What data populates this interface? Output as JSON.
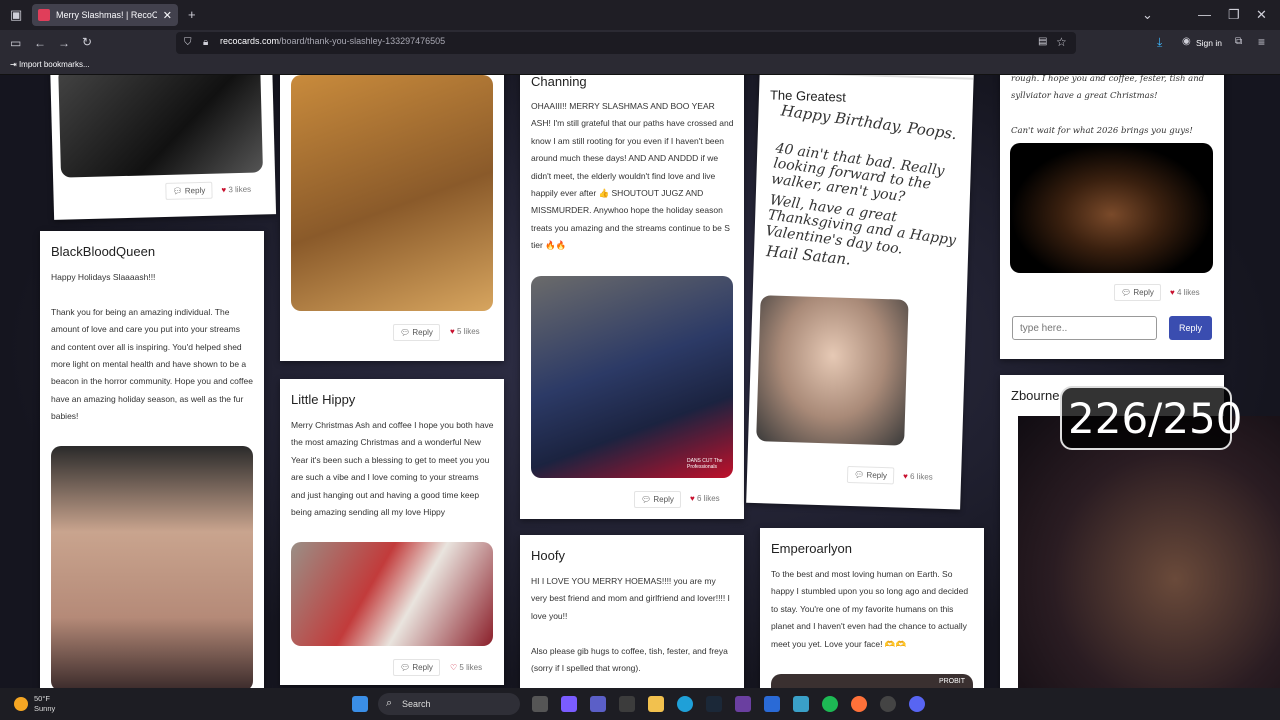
{
  "browser": {
    "tab_title": "Merry Slashmas! | RecoCards.co",
    "url_domain": "recocards.com",
    "url_path": "/board/thank-you-slashley-133297476505",
    "bookmark": "Import bookmarks...",
    "sign_in": "Sign in"
  },
  "ui": {
    "reply": "Reply",
    "reply_input_placeholder": "type here..",
    "reply_submit": "Reply"
  },
  "cards": {
    "top_left_likes": "3 likes",
    "cat_likes": "5 likes",
    "blackblood": {
      "name": "BlackBloodQueen",
      "message": "Happy Holidays Slaaaash!!!\n\nThank you for being an amazing individual. The amount of love and care you put into your streams and content over all is inspiring. You'd helped shed more light on mental health and have shown to be a beacon in the horror community. Hope you and coffee have an amazing holiday season, as well as the fur babies!"
    },
    "little_hippy": {
      "name": "Little Hippy",
      "message": "Merry Christmas Ash and coffee I hope you both have the most amazing Christmas and a wonderful New Year it's been such a blessing to get to meet you you are such a vibe and I love coming to your streams and just hanging out and having a good time keep being amazing sending all my love Hippy",
      "likes": "5 likes"
    },
    "channing": {
      "name": "Channing",
      "message": "OHAAIII!! MERRY SLASHMAS AND BOO YEAR ASH! I'm still grateful that our paths have crossed and know I am still rooting for you even if I haven't been around much these days! AND AND ANDDD if we didn't meet, the elderly wouldn't find love and live happily ever after 👍 SHOUTOUT JUGZ AND MISSMURDER. Anywhoo hope the holiday season treats you amazing and the streams continue to be S tier 🔥🔥",
      "likes": "6 likes",
      "gif_caption": "DANS CUT The Professionals"
    },
    "hoofy": {
      "name": "Hoofy",
      "message": "HI I LOVE YOU MERRY HOEMAS!!!! you are my very best friend and mom and girlfriend and lover!!!! I love you!!\n\nAlso please gib hugs to coffee, tish, fester, and freya (sorry if I spelled that wrong)."
    },
    "greatest": {
      "name": "The Greatest",
      "line1": "Happy Birthday, Poops.",
      "line2": "40 ain't that bad. Really looking forward to the walker, aren't you?",
      "line3": "Well, have a great Thanksgiving and a Happy Valentine's day too.",
      "line4": "Hail Satan.",
      "likes": "6 likes"
    },
    "emperoarlyon": {
      "name": "Emperoarlyon",
      "message": "To the best and most loving human on Earth. So happy I stumbled upon you so long ago and decided to stay. You're one of my favorite humans on this planet and I haven't even had the chance to actually meet you yet. Love your face! 🫶🫶",
      "gif_caption": "PROBIT"
    },
    "right_top": {
      "message": "rough. I hope you and coffee, fester, tish and syllviator have a great Christmas!\n\nCan't wait for what 2026 brings you guys!",
      "likes": "4 likes"
    },
    "zbourne": {
      "name": "Zbourne"
    }
  },
  "overlay": {
    "counter": "226/250"
  },
  "taskbar": {
    "temp": "50°F",
    "condition": "Sunny",
    "search": "Search"
  }
}
